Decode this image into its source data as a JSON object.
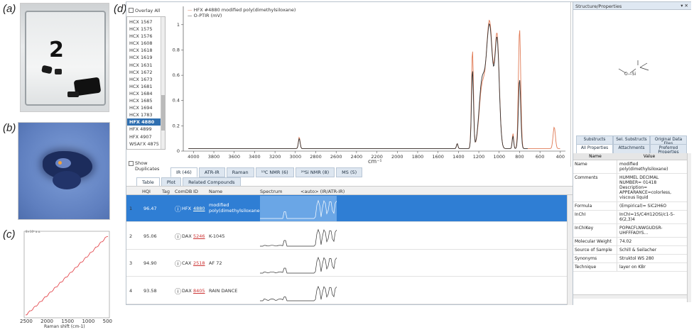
{
  "panel_labels": {
    "a": "(a)",
    "b": "(b)",
    "c": "(c)",
    "d": "(d)"
  },
  "photo_a": {
    "digit": "2"
  },
  "raman_plot": {
    "xlabel": "Raman shift (cm-1)",
    "ytick_top": "8×10⁶ a.u.",
    "x_ticks": [
      "2500",
      "2000",
      "1500",
      "1000",
      "500"
    ],
    "color": "#e0343a"
  },
  "overlay_all": "Overlay All",
  "library_items": [
    "HCX 1567",
    "HCX 1575",
    "HCX 1576",
    "HCX 1608",
    "HCX 1618",
    "HCX 1619",
    "HCX 1631",
    "HCX 1672",
    "HCX 1673",
    "HCX 1681",
    "HCX 1684",
    "HCX 1685",
    "HCX 1694",
    "HCX 1783",
    "HFX 4880",
    "HFX 4899",
    "HFX 4907",
    "WSAI'X 4875"
  ],
  "library_selected": 14,
  "show_duplicates": "Show Duplicates",
  "spectrum": {
    "legend": [
      {
        "label": "HFX #4880 modified poly(dimethylsiloxane)",
        "color": "#e07a55"
      },
      {
        "label": "O-PTIR (mV)",
        "color": "#333333"
      }
    ],
    "xlabel": "cm⁻¹",
    "x_ticks": [
      "4000",
      "3800",
      "3600",
      "3400",
      "3200",
      "3000",
      "2800",
      "2600",
      "2400",
      "2200",
      "2000",
      "1800",
      "1600",
      "1400",
      "1200",
      "1000",
      "800",
      "600",
      "400"
    ],
    "y_ticks": [
      "1",
      "0.8",
      "0.6",
      "0.4",
      "0.2",
      "0"
    ],
    "xlim": [
      4100,
      350
    ],
    "ylim": [
      0,
      1.1
    ]
  },
  "tech_tabs": [
    "IR (46)",
    "ATR-IR",
    "Raman",
    "¹³C NMR (6)",
    "²⁹Si NMR (8)",
    "MS (5)"
  ],
  "view_tabs": [
    "Table",
    "Plot",
    "Related Compounds"
  ],
  "columns": {
    "hqi": "HQI",
    "tag": "Tag",
    "comdb": "ComDB",
    "id": "ID",
    "name": "Name",
    "spectrum": "Spectrum",
    "spectrum_sub": "<auto> (IR/ATR-IR)"
  },
  "results": [
    {
      "n": "1",
      "hqi": "96.47",
      "db": "HFX",
      "id": "4880",
      "name": "modified poly(dimethylsiloxane)"
    },
    {
      "n": "2",
      "hqi": "95.06",
      "db": "DAX",
      "id": "5246",
      "name": "K-1045"
    },
    {
      "n": "3",
      "hqi": "94.90",
      "db": "CAX",
      "id": "2518",
      "name": "AF 72"
    },
    {
      "n": "4",
      "hqi": "93.58",
      "db": "DAX",
      "id": "8405",
      "name": "RAIN DANCE"
    }
  ],
  "structure_panel": {
    "title": "Structure/Properties",
    "molecule_label": "O—Si",
    "pin": "▾ ✕"
  },
  "prop_tabs_row1": [
    "Substructs",
    "Sel. Substructs",
    "Original Data Files"
  ],
  "prop_tabs_row2": [
    "All Properties",
    "Attachments",
    "Preferred Properties"
  ],
  "prop_header": {
    "name": "Name",
    "value": "Value"
  },
  "properties": [
    {
      "name": "Name",
      "value": "modified poly(dimethylsiloxane)"
    },
    {
      "name": "Comments",
      "value": "HUMMEL DECIMAL NUMBER= 01418 Description= APPEARANCE=colorless, viscous liquid"
    },
    {
      "name": "Formula",
      "value": "(Empirical)= SiC2H6O"
    },
    {
      "name": "InChI",
      "value": "InChI=1S/C4H12OSi/c1-5-6(2,3)4"
    },
    {
      "name": "InChIKey",
      "value": "POPACFLNWGUDSR-UHFFFAOYS..."
    },
    {
      "name": "Molecular Weight",
      "value": "74.02"
    },
    {
      "name": "Source of Sample",
      "value": "Schill & Seilacher"
    },
    {
      "name": "Synonyms",
      "value": "Struktol WS 280"
    },
    {
      "name": "Technique",
      "value": "layer on KBr"
    }
  ]
}
